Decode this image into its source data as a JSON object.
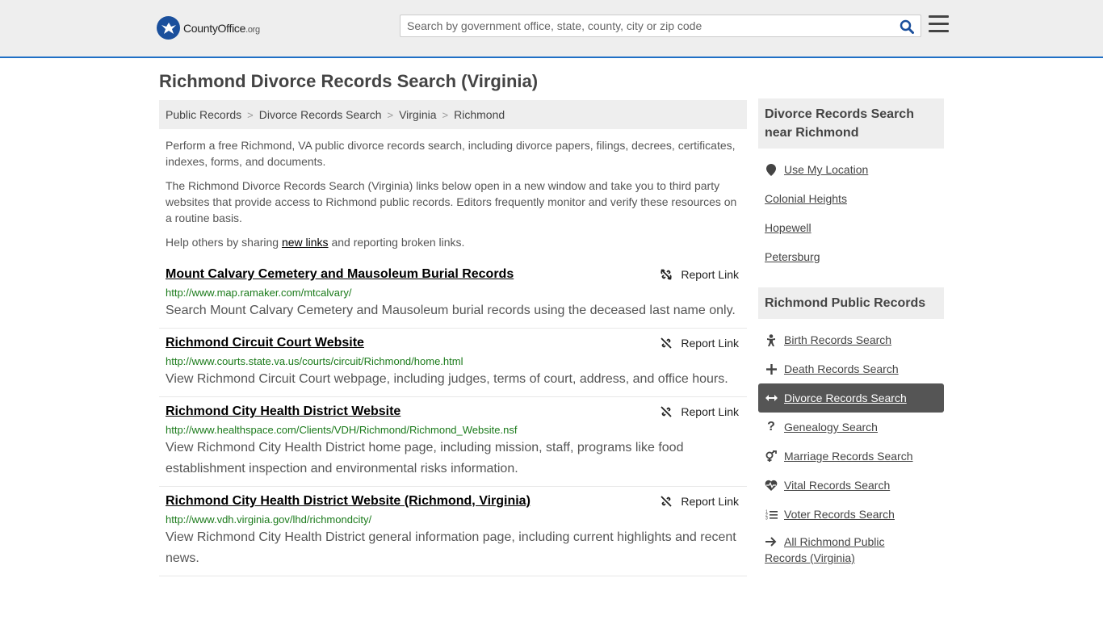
{
  "header": {
    "logo_text": "CountyOffice",
    "logo_tld": ".org",
    "search_placeholder": "Search by government office, state, county, city or zip code"
  },
  "page_title": "Richmond Divorce Records Search (Virginia)",
  "breadcrumb": [
    "Public Records",
    "Divorce Records Search",
    "Virginia",
    "Richmond"
  ],
  "intro": {
    "p1": "Perform a free Richmond, VA public divorce records search, including divorce papers, filings, decrees, certificates, indexes, forms, and documents.",
    "p2": "The Richmond Divorce Records Search (Virginia) links below open in a new window and take you to third party websites that provide access to Richmond public records. Editors frequently monitor and verify these resources on a routine basis.",
    "p3_before": "Help others by sharing ",
    "p3_link": "new links",
    "p3_after": " and reporting broken links."
  },
  "report_label": "Report Link",
  "records": [
    {
      "title": "Mount Calvary Cemetery and Mausoleum Burial Records",
      "url": "http://www.map.ramaker.com/mtcalvary/",
      "desc": "Search Mount Calvary Cemetery and Mausoleum burial records using the deceased last name only."
    },
    {
      "title": "Richmond Circuit Court Website",
      "url": "http://www.courts.state.va.us/courts/circuit/Richmond/home.html",
      "desc": "View Richmond Circuit Court webpage, including judges, terms of court, address, and office hours."
    },
    {
      "title": "Richmond City Health District Website",
      "url": "http://www.healthspace.com/Clients/VDH/Richmond/Richmond_Website.nsf",
      "desc": "View Richmond City Health District home page, including mission, staff, programs like food establishment inspection and environmental risks information."
    },
    {
      "title": "Richmond City Health District Website (Richmond, Virginia)",
      "url": "http://www.vdh.virginia.gov/lhd/richmondcity/",
      "desc": "View Richmond City Health District general information page, including current highlights and recent news."
    }
  ],
  "sidebar": {
    "near_heading": "Divorce Records Search near Richmond",
    "near_items": [
      {
        "label": "Use My Location",
        "icon": "map-pin-icon"
      },
      {
        "label": "Colonial Heights"
      },
      {
        "label": "Hopewell"
      },
      {
        "label": "Petersburg"
      }
    ],
    "records_heading": "Richmond Public Records",
    "records_items": [
      {
        "label": "Birth Records Search",
        "icon": "baby-icon"
      },
      {
        "label": "Death Records Search",
        "icon": "cross-icon"
      },
      {
        "label": "Divorce Records Search",
        "icon": "split-arrows-icon",
        "active": true
      },
      {
        "label": "Genealogy Search",
        "icon": "question-icon"
      },
      {
        "label": "Marriage Records Search",
        "icon": "venus-mars-icon"
      },
      {
        "label": "Vital Records Search",
        "icon": "heartbeat-icon"
      },
      {
        "label": "Voter Records Search",
        "icon": "list-icon"
      },
      {
        "label": "All Richmond Public Records (Virginia)",
        "icon": "arrow-right-icon"
      }
    ]
  },
  "colors": {
    "header_bg": "#eeeeee",
    "header_border": "#1f6fc5",
    "url_green": "#1a7a1a",
    "active_bg": "#555555"
  }
}
